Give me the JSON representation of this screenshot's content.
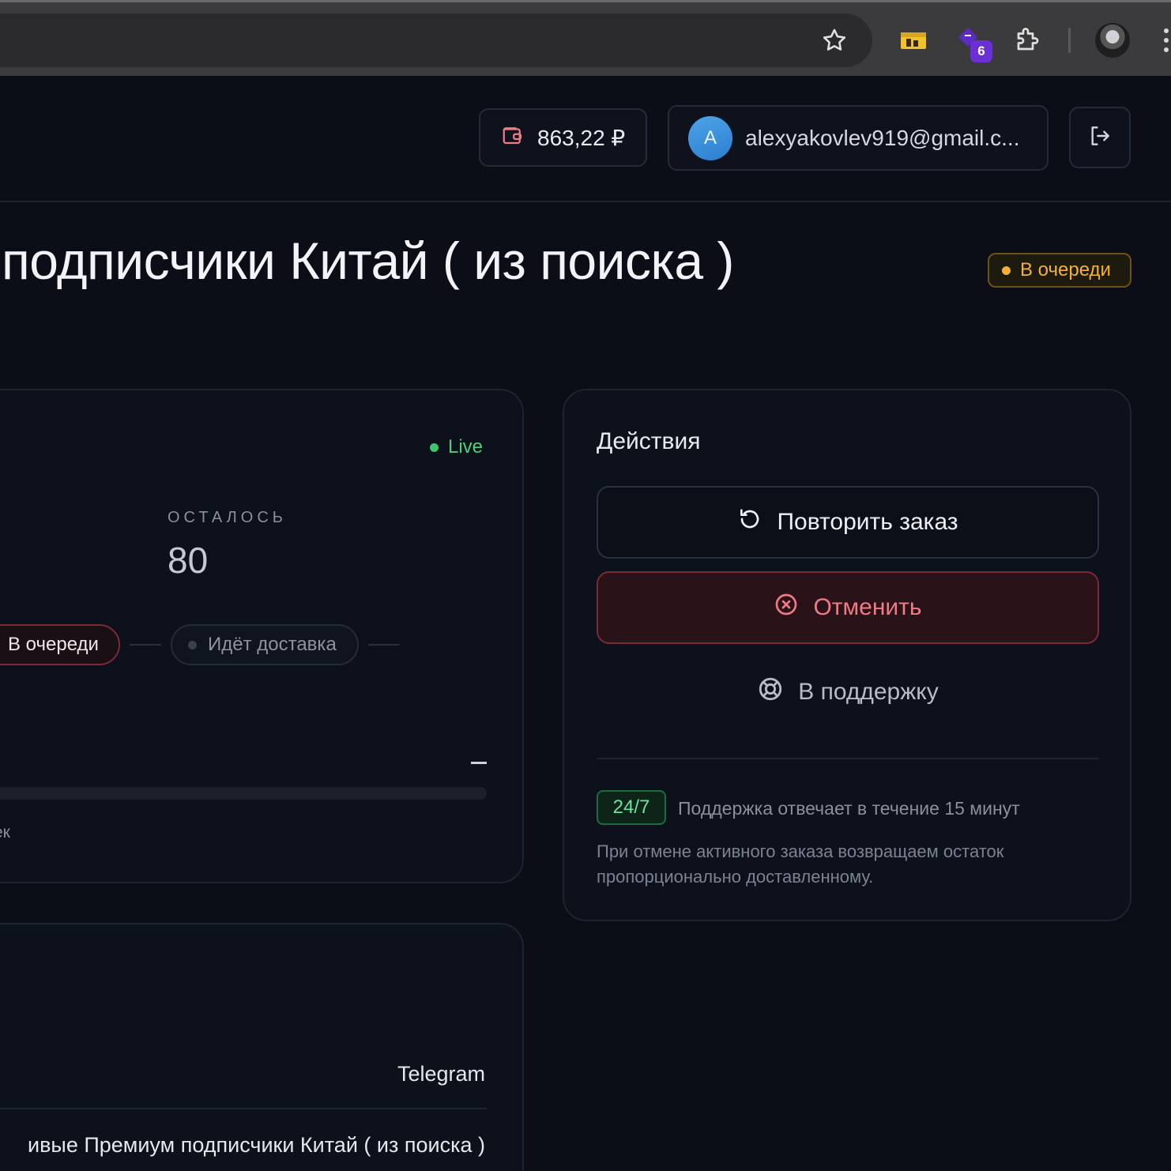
{
  "browser": {
    "extension_badge": "6"
  },
  "header": {
    "balance": "863,22 ₽",
    "user": {
      "avatar_letter": "A",
      "email": "alexyakovlev919@gmail.c..."
    }
  },
  "order": {
    "title": "подписчики Китай ( из поиска )",
    "status": "В очереди",
    "status_color": "#f5b03a"
  },
  "progress": {
    "live_label": "Live",
    "remaining_caption": "ОСТАЛОСЬ",
    "remaining_value": "80",
    "steps": [
      {
        "label": "В очереди",
        "active": true
      },
      {
        "label": "Идёт доставка",
        "active": false
      }
    ],
    "speed_value": "—",
    "percent": 0,
    "footer_fragment": "ек"
  },
  "details": {
    "platform": "Telegram",
    "service": "ивые Премиум подписчики Китай ( из поиска )"
  },
  "actions": {
    "title": "Действия",
    "repeat_label": "Повторить заказ",
    "cancel_label": "Отменить",
    "support_label": "В поддержку",
    "sla_badge": "24/7",
    "sla_text": "Поддержка отвечает в течение 15 минут",
    "refund_note": "При отмене активного заказа возвращаем остаток пропорционально доставленному."
  },
  "colors": {
    "live": "#4ed07a",
    "cancel": "#f07a85",
    "queue_dot": "#f5b03a"
  }
}
